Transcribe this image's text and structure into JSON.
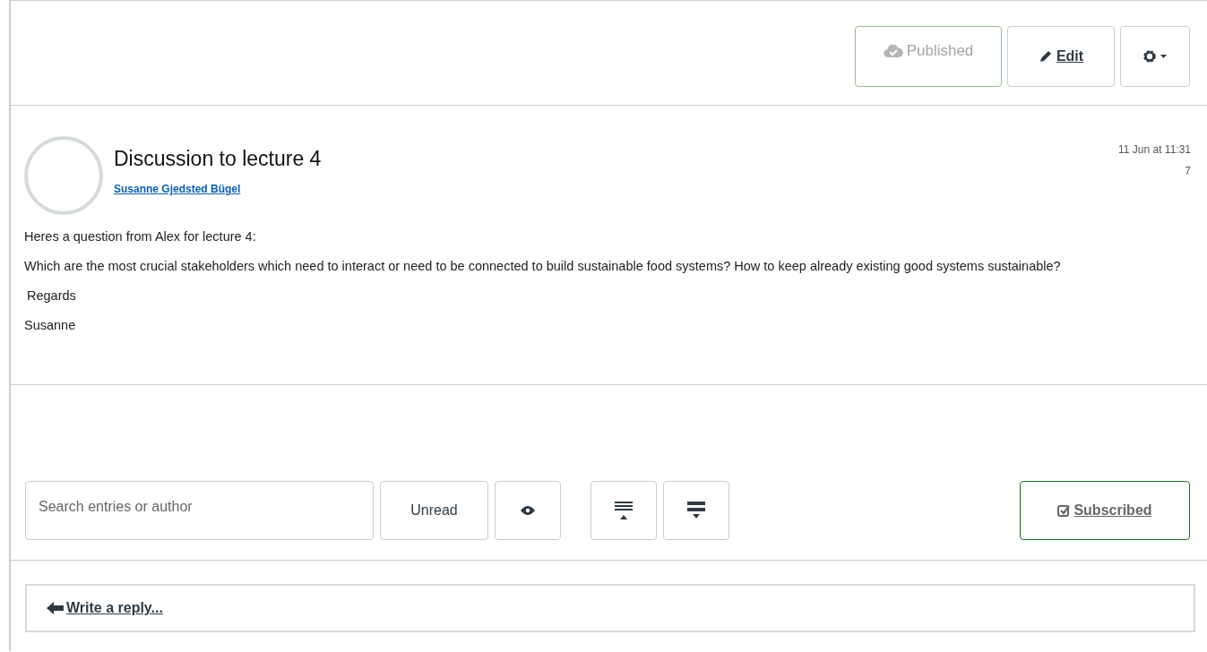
{
  "header": {
    "published": {
      "label": "Published",
      "on": true
    },
    "edit": {
      "label": "Edit"
    }
  },
  "post": {
    "title": "Discussion to lecture 4",
    "author": "Susanne Gjedsted Bügel",
    "date": "11 Jun at 11:31",
    "count": "7",
    "body": [
      "Heres a question from Alex for lecture 4:",
      "Which are the most crucial stakeholders which need to interact or need to be connected to build sustainable food systems? How to keep already existing good systems sustainable?",
      "Regards",
      "Susanne"
    ]
  },
  "toolbar": {
    "search": {
      "placeholder": "Search entries or author"
    },
    "unread": {
      "label": "Unread"
    },
    "subscribe": {
      "label": "Subscribed",
      "on": true
    }
  },
  "reply": {
    "label": "Write a reply..."
  }
}
